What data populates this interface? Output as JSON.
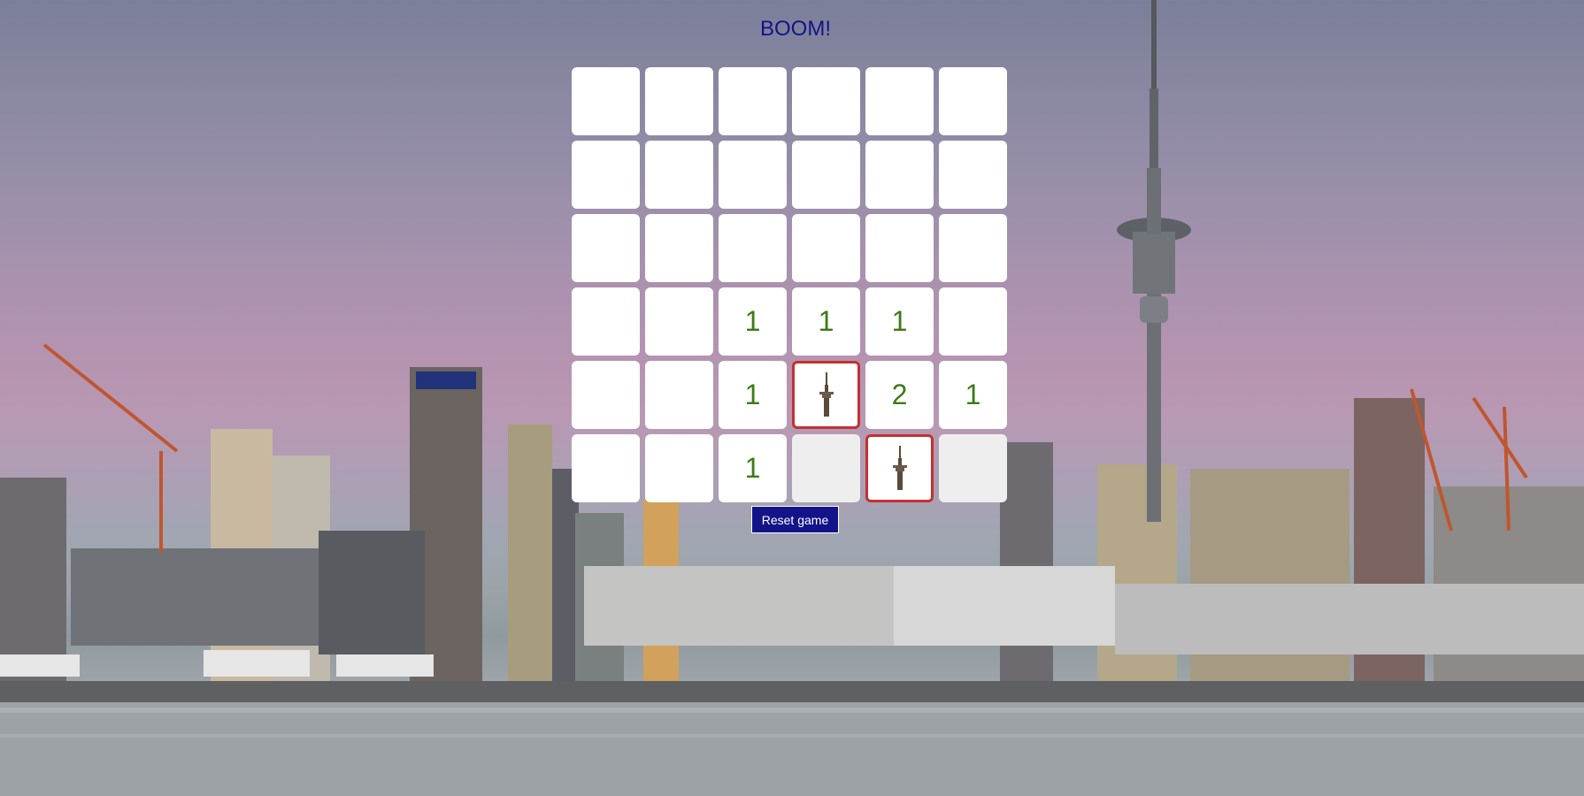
{
  "game": {
    "status_text": "BOOM!",
    "reset_label": "Reset game",
    "rows": 6,
    "cols": 6,
    "grid": [
      [
        "",
        "",
        "",
        "",
        "",
        ""
      ],
      [
        "",
        "",
        "",
        "",
        "",
        ""
      ],
      [
        "",
        "",
        "",
        "",
        "",
        ""
      ],
      [
        "",
        "",
        "1",
        "1",
        "1",
        ""
      ],
      [
        "",
        "",
        "1",
        "mine",
        "2",
        "1"
      ],
      [
        "",
        "",
        "1",
        "empty",
        "mine",
        "empty"
      ]
    ],
    "mine_icon": "sky-tower-icon"
  },
  "colors": {
    "title": "#13138a",
    "number": "#3c7a17",
    "mine_border": "#c53030",
    "button_bg": "#13138a"
  }
}
